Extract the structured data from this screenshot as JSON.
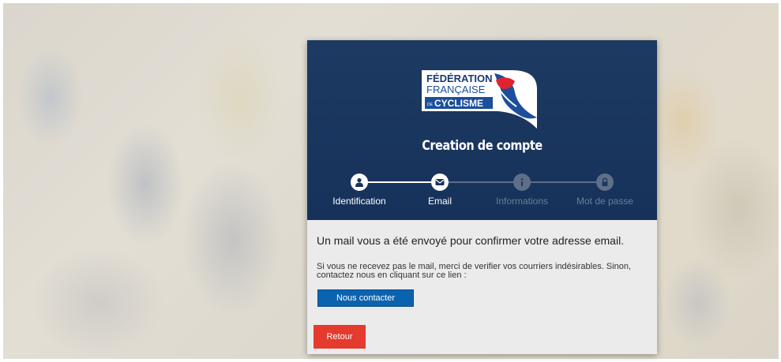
{
  "brand": {
    "line1": "FÉDÉRATION",
    "line2": "FRANÇAISE",
    "line3_prefix": "DE",
    "line3": "CYCLISME"
  },
  "header": {
    "title": "Creation de compte"
  },
  "stepper": {
    "steps": [
      {
        "label": "Identification",
        "icon": "user-icon",
        "state": "done"
      },
      {
        "label": "Email",
        "icon": "envelope-icon",
        "state": "current"
      },
      {
        "label": "Informations",
        "icon": "info-icon",
        "state": "todo"
      },
      {
        "label": "Mot de passe",
        "icon": "lock-icon",
        "state": "todo"
      }
    ]
  },
  "content": {
    "main_message": "Un mail vous a été envoyé pour confirmer votre adresse email.",
    "sub_message": "Si vous ne recevez pas le mail, merci de verifier vos courriers indésirables. Sinon, contactez nous en cliquant sur ce lien :",
    "contact_button": "Nous contacter",
    "back_button": "Retour"
  },
  "colors": {
    "header_bg": "#1d3a62",
    "contact_button": "#0b63b0",
    "back_button": "#e53a2e",
    "step_inactive": "#5e6f87"
  }
}
